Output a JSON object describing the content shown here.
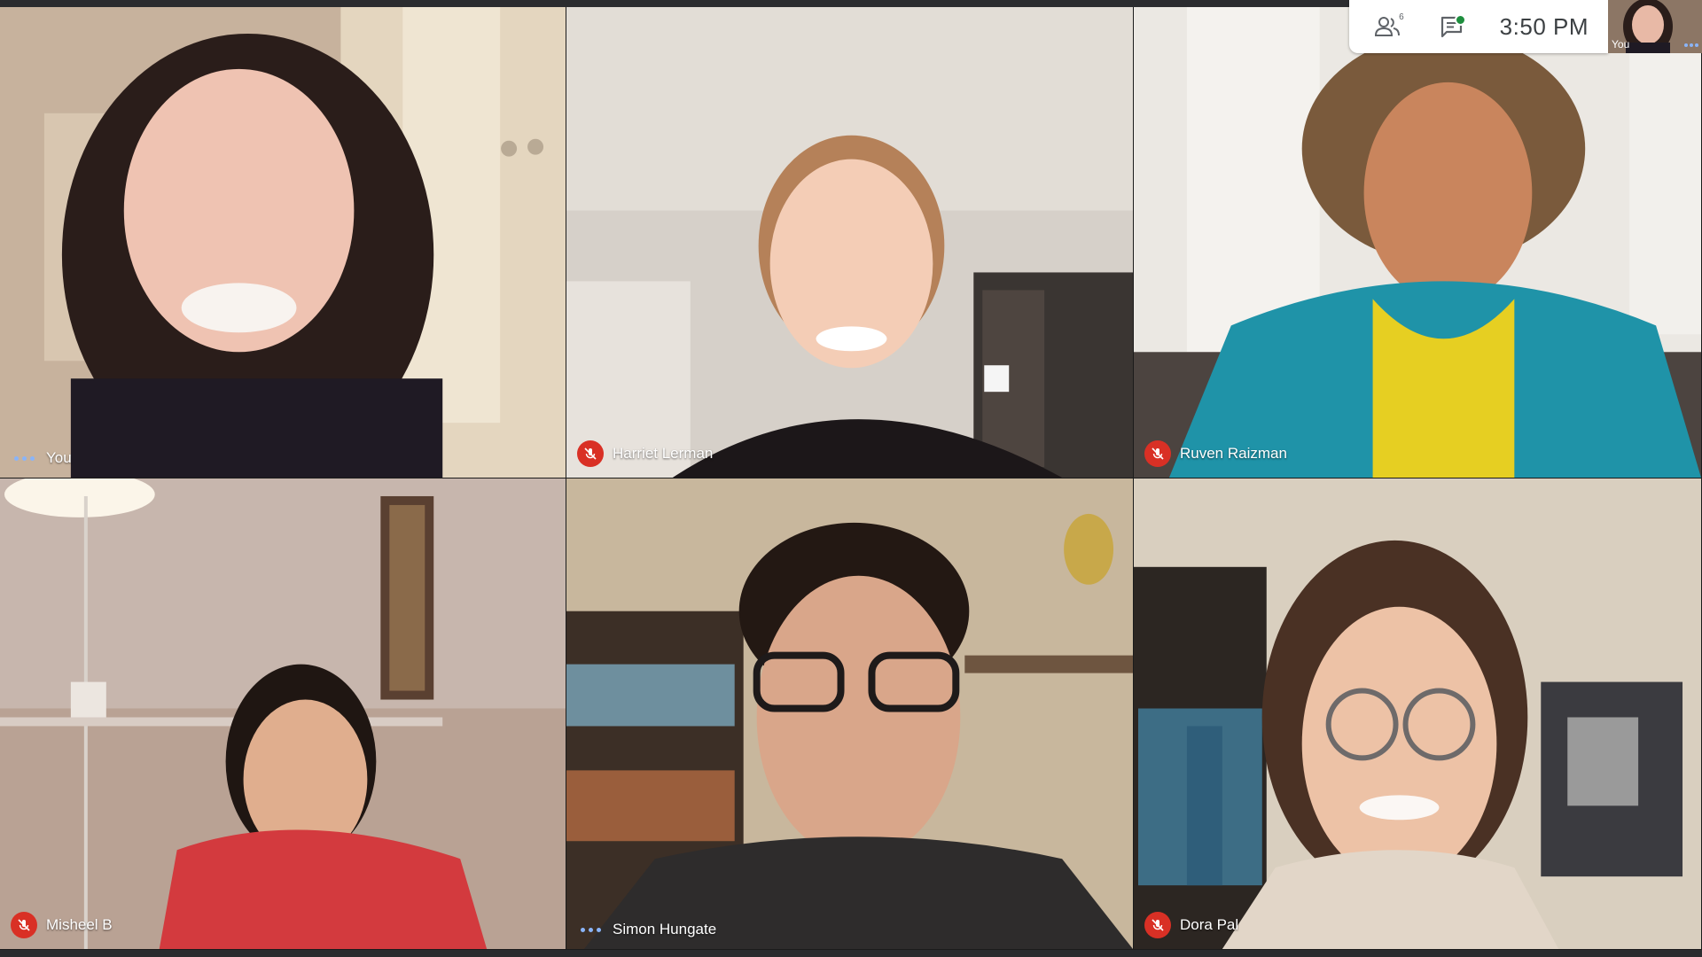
{
  "topbar": {
    "participants_count": "6",
    "time": "3:50  PM",
    "self_label": "You",
    "icons": [
      "people-icon",
      "chat-icon",
      "more-options-icon"
    ]
  },
  "tiles": [
    {
      "name": "You",
      "status": "more-options",
      "palette": [
        "#d9c3a8",
        "#3a2a22",
        "#e6b8a0"
      ]
    },
    {
      "name": "Harriet Lerman",
      "status": "muted",
      "palette": [
        "#d8d2cc",
        "#a8764e",
        "#f0c8ae"
      ]
    },
    {
      "name": "Ruven Raizman",
      "status": "muted",
      "palette": [
        "#e6e2dc",
        "#6f4f33",
        "#d9a078"
      ]
    },
    {
      "name": "Misheel B",
      "status": "muted",
      "palette": [
        "#c5b3a7",
        "#2a1c16",
        "#e3b595"
      ]
    },
    {
      "name": "Simon Hungate",
      "status": "more-options",
      "palette": [
        "#cdbba2",
        "#2a1d17",
        "#d9a98c"
      ]
    },
    {
      "name": "Dora Pal",
      "status": "muted",
      "palette": [
        "#d6cab8",
        "#4a3124",
        "#eabb9e"
      ]
    }
  ],
  "colors": {
    "mute_red": "#d93025",
    "dot_blue": "#8ab4f8",
    "online_green": "#1e8e3e"
  }
}
